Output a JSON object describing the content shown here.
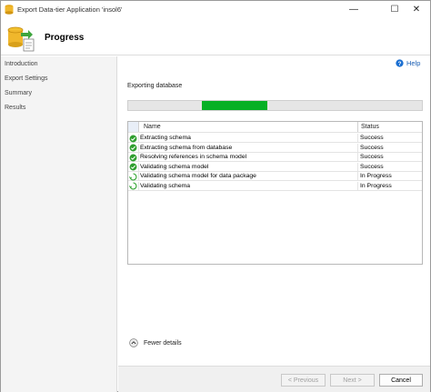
{
  "window": {
    "title": "Export Data-tier Application 'insol6'",
    "minimize_glyph": "—",
    "maximize_glyph": "☐",
    "close_glyph": "✕"
  },
  "header": {
    "title": "Progress",
    "icon": "database-export-icon"
  },
  "nav": {
    "items": [
      {
        "label": "Introduction"
      },
      {
        "label": "Export Settings"
      },
      {
        "label": "Summary"
      },
      {
        "label": "Results"
      }
    ]
  },
  "help": {
    "label": "Help",
    "icon": "help-icon"
  },
  "progress": {
    "label": "Exporting database",
    "fill_start": 0.25,
    "fill_fraction": 0.225,
    "color": "#06b025"
  },
  "grid": {
    "columns": {
      "name": "Name",
      "status": "Status"
    },
    "rows": [
      {
        "name": "Extracting schema",
        "status": "Success",
        "state": "success"
      },
      {
        "name": "Extracting schema from database",
        "status": "Success",
        "state": "success"
      },
      {
        "name": "Resolving references in schema model",
        "status": "Success",
        "state": "success"
      },
      {
        "name": "Validating schema model",
        "status": "Success",
        "state": "success"
      },
      {
        "name": "Validating schema model for data package",
        "status": "In Progress",
        "state": "progress"
      },
      {
        "name": "Validating schema",
        "status": "In Progress",
        "state": "progress"
      }
    ]
  },
  "details": {
    "label": "Fewer details",
    "icon": "collapse-up-icon"
  },
  "footer": {
    "previous": "< Previous",
    "next": "Next >",
    "cancel": "Cancel"
  },
  "colors": {
    "success": "#2e9e2e",
    "progress": "#3aa83a",
    "link": "#1b5fb4"
  }
}
